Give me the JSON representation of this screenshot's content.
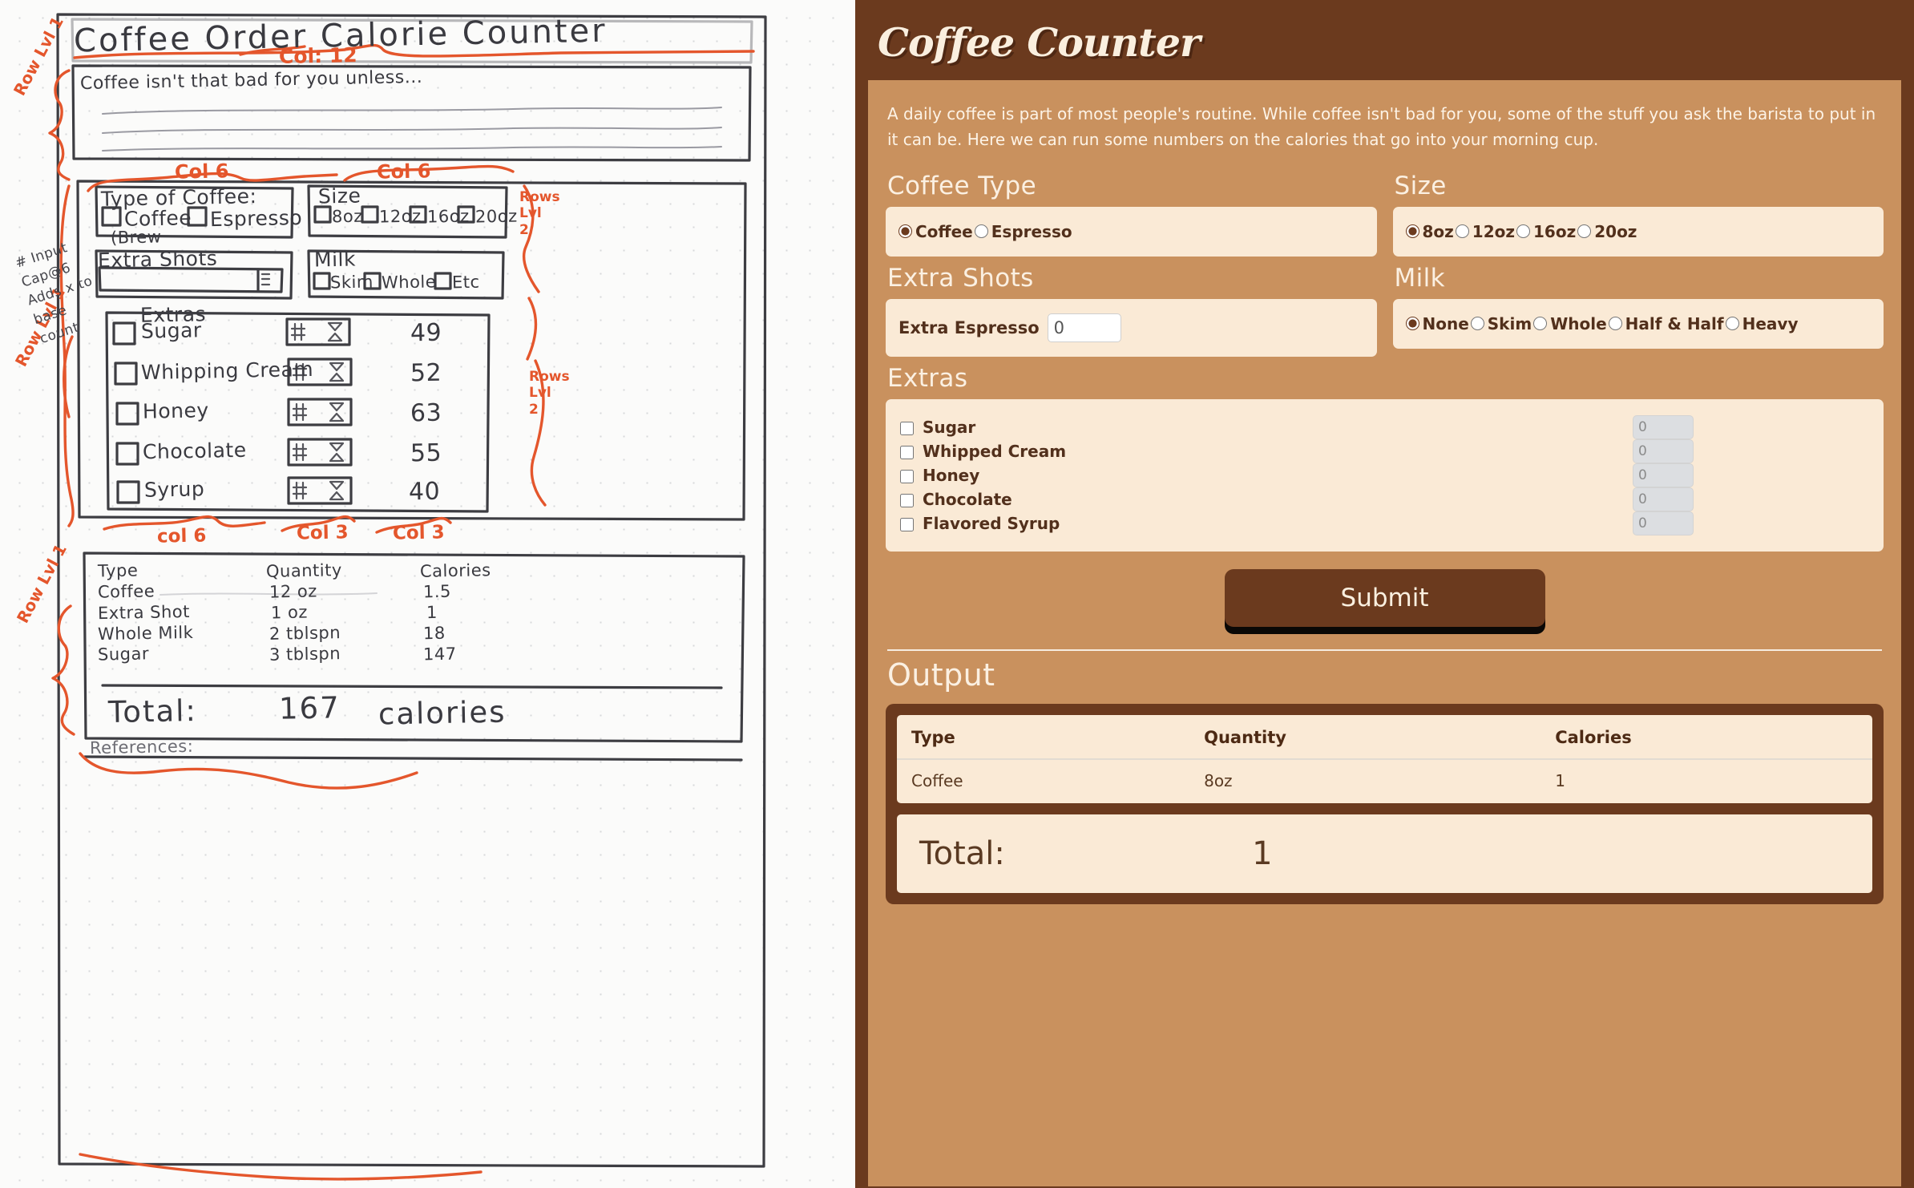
{
  "app": {
    "title": "Coffee Counter",
    "intro": "A daily coffee is part of most people's routine. While coffee isn't bad for you, some of the stuff you ask the barista to put in it can be. Here we can run some numbers on the calories that go into your morning cup.",
    "colors": {
      "shell_brown": "#6b3a1e",
      "panel_tan": "#c9915e",
      "card_cream": "#faead6",
      "text_cream": "#fbf0e2",
      "text_dark": "#52301c",
      "disabled_gray": "#dcdee1"
    },
    "sections": {
      "coffee_type": "Coffee Type",
      "size": "Size",
      "extra_shots": "Extra Shots",
      "milk": "Milk",
      "extras": "Extras",
      "output": "Output"
    },
    "coffee_type": {
      "options": [
        {
          "label": "Coffee",
          "checked": true
        },
        {
          "label": "Espresso",
          "checked": false
        }
      ]
    },
    "size": {
      "options": [
        {
          "label": "8oz",
          "checked": true
        },
        {
          "label": "12oz",
          "checked": false
        },
        {
          "label": "16oz",
          "checked": false
        },
        {
          "label": "20oz",
          "checked": false
        }
      ]
    },
    "extra_shots": {
      "label": "Extra Espresso",
      "value": "0",
      "placeholder": "0"
    },
    "milk": {
      "options": [
        {
          "label": "None",
          "checked": true
        },
        {
          "label": "Skim",
          "checked": false
        },
        {
          "label": "Whole",
          "checked": false
        },
        {
          "label": "Half & Half",
          "checked": false
        },
        {
          "label": "Heavy",
          "checked": false
        }
      ]
    },
    "extras": {
      "rows": [
        {
          "label": "Sugar",
          "checked": false,
          "qty": "0"
        },
        {
          "label": "Whipped Cream",
          "checked": false,
          "qty": "0"
        },
        {
          "label": "Honey",
          "checked": false,
          "qty": "0"
        },
        {
          "label": "Chocolate",
          "checked": false,
          "qty": "0"
        },
        {
          "label": "Flavored Syrup",
          "checked": false,
          "qty": "0"
        }
      ]
    },
    "submit_label": "Submit",
    "output": {
      "headers": [
        "Type",
        "Quantity",
        "Calories"
      ],
      "rows": [
        [
          "Coffee",
          "8oz",
          "1"
        ]
      ],
      "total_label": "Total:",
      "total_value": "1"
    }
  },
  "sketch": {
    "title": "Coffee Order Calorie Counter",
    "paragraph_line": "Coffee isn't that bad for you unless...",
    "type_header": "Type of Coffee:",
    "type_options": [
      "Coffee",
      "Espresso"
    ],
    "type_sub": "(Brew",
    "size_header": "Size",
    "size_options": [
      "8oz",
      "12oz",
      "16oz",
      "20oz"
    ],
    "shots_header": "Extra Shots",
    "milk_header": "Milk",
    "milk_options": [
      "Skim",
      "Whole",
      "Etc"
    ],
    "extras_header": "Extras",
    "extras_rows": [
      {
        "label": "Sugar",
        "calories": "49"
      },
      {
        "label": "Whipping Cream",
        "calories": "52"
      },
      {
        "label": "Honey",
        "calories": "63"
      },
      {
        "label": "Chocolate",
        "calories": "55"
      },
      {
        "label": "Syrup",
        "calories": "40"
      }
    ],
    "table_headers": [
      "Type",
      "Quantity",
      "Calories"
    ],
    "table_rows": [
      [
        "Coffee",
        "12 oz",
        "1.5"
      ],
      [
        "Extra Shot",
        "1 oz",
        "1"
      ],
      [
        "Whole Milk",
        "2 tblspn",
        "18"
      ],
      [
        "Sugar",
        "3 tblspn",
        "147"
      ]
    ],
    "total_label": "Total:",
    "total_value": "167",
    "total_unit": "calories",
    "references_label": "References:",
    "annotations": {
      "col12": "Col: 12",
      "col6_left": "Col 6",
      "col6_right": "Col 6",
      "col6_bottom": "col 6",
      "col3_a": "Col 3",
      "col3_b": "Col 3",
      "row_lvl1_top": "Row Lvl 1",
      "row_lvl1_mid": "Row Lvl 1",
      "row_lvl1_bottom": "Row Lvl 1",
      "input_note": "# Input Cap@6 Adds x to base count",
      "rows_note_right": "Rows Lvl 2"
    }
  }
}
